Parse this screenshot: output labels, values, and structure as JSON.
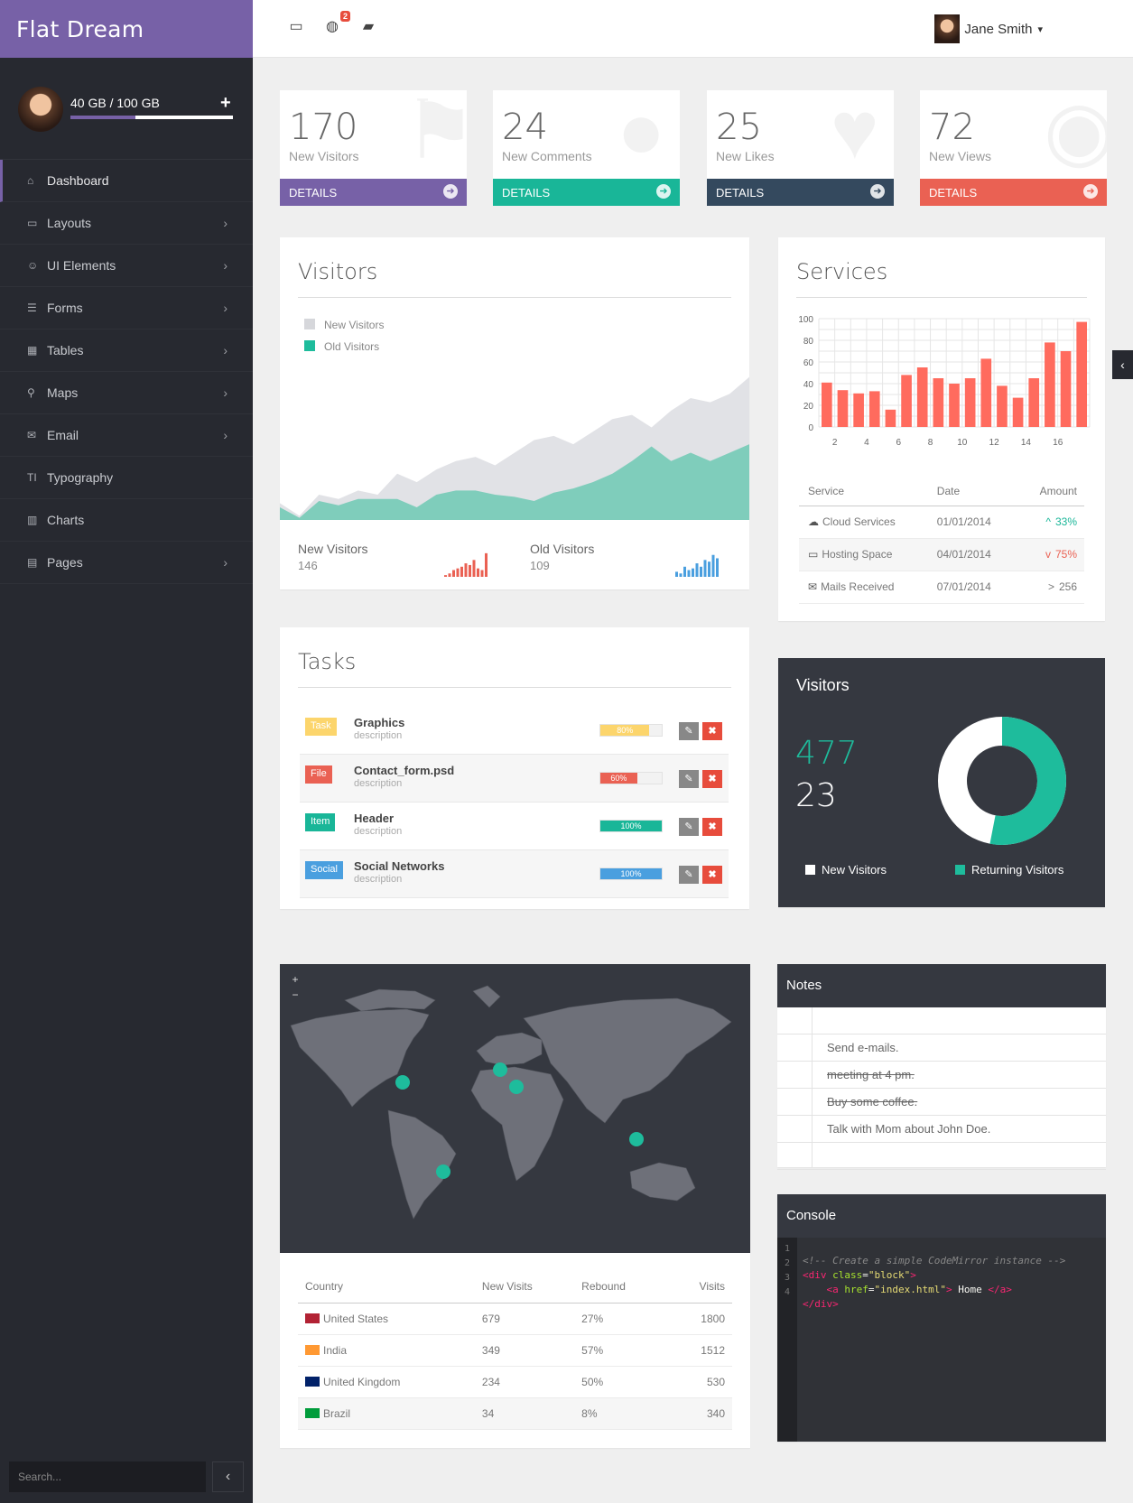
{
  "app": {
    "title": "Flat Dream",
    "storage": "40 GB / 100 GB",
    "storage_used": 0.4
  },
  "sidebar": {
    "items": [
      {
        "label": "Dashboard",
        "icon": "home-icon",
        "glyph": "⌂",
        "chev": ""
      },
      {
        "label": "Layouts",
        "icon": "desktop-icon",
        "glyph": "▭",
        "chev": "›"
      },
      {
        "label": "UI Elements",
        "icon": "smile-icon",
        "glyph": "☺",
        "chev": "›"
      },
      {
        "label": "Forms",
        "icon": "list-alt-icon",
        "glyph": "☰",
        "chev": "›"
      },
      {
        "label": "Tables",
        "icon": "table-icon",
        "glyph": "▦",
        "chev": "›"
      },
      {
        "label": "Maps",
        "icon": "map-marker-icon",
        "glyph": "⚲",
        "chev": "›"
      },
      {
        "label": "Email",
        "icon": "envelope-icon",
        "glyph": "✉",
        "chev": "›"
      },
      {
        "label": "Typography",
        "icon": "text-height-icon",
        "glyph": "TI",
        "chev": ""
      },
      {
        "label": "Charts",
        "icon": "bar-chart-icon",
        "glyph": "▥",
        "chev": ""
      },
      {
        "label": "Pages",
        "icon": "file-icon",
        "glyph": "▤",
        "chev": "›"
      }
    ],
    "search_placeholder": "Search...",
    "collapse_glyph": "‹"
  },
  "topbar": {
    "notif_count": "2",
    "user": "Jane Smith",
    "caret": "▾"
  },
  "stats": [
    {
      "num": "170",
      "label": "New Visitors",
      "footer": "DETAILS",
      "color": "#7761a7",
      "bgicon": "⚑"
    },
    {
      "num": "24",
      "label": "New Comments",
      "footer": "DETAILS",
      "color": "#19b698",
      "bgicon": "●"
    },
    {
      "num": "25",
      "label": "New Likes",
      "footer": "DETAILS",
      "color": "#34495e",
      "bgicon": "♥"
    },
    {
      "num": "72",
      "label": "New Views",
      "footer": "DETAILS",
      "color": "#ea6153",
      "bgicon": "◉"
    }
  ],
  "visitors": {
    "title": "Visitors",
    "legend": [
      "New Visitors",
      "Old Visitors"
    ],
    "new_label": "New Visitors",
    "new_value": "146",
    "old_label": "Old Visitors",
    "old_value": "109"
  },
  "services": {
    "title": "Services",
    "columns": [
      "Service",
      "Date",
      "Amount"
    ],
    "rows": [
      {
        "service": "Cloud Services",
        "date": "01/01/2014",
        "amount": "33%",
        "trend": "^",
        "color": "#19b698",
        "icon": "cloud-icon",
        "glyph": "☁"
      },
      {
        "service": "Hosting Space",
        "date": "04/01/2014",
        "amount": "75%",
        "trend": "v",
        "color": "#ea6153",
        "icon": "inbox-icon",
        "glyph": "▭"
      },
      {
        "service": "Mails Received",
        "date": "07/01/2014",
        "amount": "256",
        "trend": ">",
        "color": "#777",
        "icon": "envelope-icon",
        "glyph": "✉"
      }
    ]
  },
  "chart_data": [
    {
      "type": "area",
      "title": "Visitors",
      "series": [
        {
          "name": "New Visitors",
          "values": [
            8,
            2,
            12,
            10,
            14,
            12,
            22,
            18,
            24,
            28,
            30,
            26,
            32,
            38,
            40,
            36,
            42,
            48,
            50,
            44,
            52,
            58,
            56,
            60,
            68
          ]
        },
        {
          "name": "Old Visitors",
          "values": [
            6,
            1,
            9,
            7,
            10,
            10,
            10,
            6,
            12,
            14,
            14,
            12,
            11,
            9,
            13,
            15,
            18,
            22,
            28,
            35,
            28,
            32,
            28,
            32,
            36
          ]
        }
      ],
      "colors": [
        "#e1e2e6",
        "#7fcdbb"
      ]
    },
    {
      "type": "bar",
      "title": "Services",
      "x": [
        1,
        2,
        3,
        4,
        5,
        6,
        7,
        8,
        9,
        10,
        11,
        12,
        13,
        14,
        15,
        16,
        17,
        18
      ],
      "values": [
        41,
        34,
        31,
        33,
        16,
        48,
        55,
        45,
        40,
        45,
        63,
        38,
        27,
        45,
        78,
        70,
        97
      ],
      "xticks": [
        "2",
        "4",
        "6",
        "8",
        "10",
        "12",
        "14",
        "16"
      ],
      "yticks": [
        "100",
        "80",
        "60",
        "40",
        "20",
        "0"
      ],
      "ylim": [
        0,
        100
      ],
      "color": "#ff6b5e"
    },
    {
      "type": "bar",
      "title": "New Visitors sparkline",
      "values": [
        2,
        4,
        8,
        10,
        12,
        16,
        14,
        20,
        10,
        8,
        28
      ],
      "color": "#ea6153"
    },
    {
      "type": "bar",
      "title": "Old Visitors sparkline",
      "values": [
        6,
        4,
        12,
        8,
        10,
        16,
        12,
        20,
        18,
        26,
        22
      ],
      "color": "#4a9fdf"
    },
    {
      "type": "pie",
      "title": "Visitors",
      "values": [
        477,
        23
      ],
      "legend": [
        "New Visitors",
        "Returning Visitors"
      ],
      "colors": [
        "#ffffff",
        "#1ebc9c"
      ]
    }
  ],
  "tasks": {
    "title": "Tasks",
    "items": [
      {
        "tag": "Task",
        "tagcolor": "#fcd56c",
        "name": "Graphics",
        "desc": "description",
        "progress": "80%",
        "pct": 0.8,
        "pcolor": "#fcd56c"
      },
      {
        "tag": "File",
        "tagcolor": "#ea6153",
        "name": "Contact_form.psd",
        "desc": "description",
        "progress": "60%",
        "pct": 0.6,
        "pcolor": "#ea6153"
      },
      {
        "tag": "Item",
        "tagcolor": "#19b698",
        "name": "Header",
        "desc": "description",
        "progress": "100%",
        "pct": 1,
        "pcolor": "#19b698"
      },
      {
        "tag": "Social",
        "tagcolor": "#4a9fdf",
        "name": "Social Networks",
        "desc": "description",
        "progress": "100%",
        "pct": 1,
        "pcolor": "#4a9fdf"
      }
    ],
    "edit_glyph": "✎",
    "remove_glyph": "✖"
  },
  "donut": {
    "title": "Visitors",
    "big": "477",
    "small": "23",
    "legend": [
      "New Visitors",
      "Returning Visitors"
    ]
  },
  "map": {
    "zoom_in": "+",
    "zoom_out": "−",
    "columns": [
      "Country",
      "New Visits",
      "Rebound",
      "Visits"
    ],
    "rows": [
      {
        "country": "United States",
        "new": "679",
        "rebound": "27%",
        "visits": "1800",
        "flag": "#b22234"
      },
      {
        "country": "India",
        "new": "349",
        "rebound": "57%",
        "visits": "1512",
        "flag": "#ff9933"
      },
      {
        "country": "United Kingdom",
        "new": "234",
        "rebound": "50%",
        "visits": "530",
        "flag": "#012169"
      },
      {
        "country": "Brazil",
        "new": "34",
        "rebound": "8%",
        "visits": "340",
        "flag": "#009c3b"
      }
    ]
  },
  "notes": {
    "title": "Notes",
    "lines": [
      {
        "text": "",
        "done": false
      },
      {
        "text": "Send e-mails.",
        "done": false
      },
      {
        "text": "meeting at 4 pm.",
        "done": true
      },
      {
        "text": "Buy some coffee.",
        "done": true
      },
      {
        "text": "Talk with Mom about John Doe.",
        "done": false
      },
      {
        "text": "",
        "done": false
      }
    ]
  },
  "console": {
    "title": "Console",
    "gutter": [
      "1",
      "2",
      "3",
      "4"
    ]
  }
}
